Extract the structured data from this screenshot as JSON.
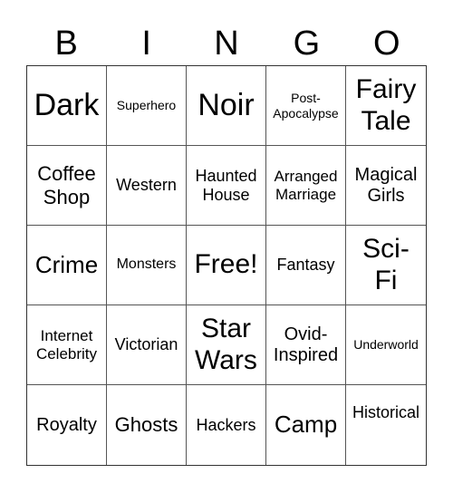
{
  "header": [
    "B",
    "I",
    "N",
    "G",
    "O"
  ],
  "cells": [
    "Dark",
    "Superhero",
    "Noir",
    "Post-\nApocalypse",
    "Fairy\nTale",
    "Coffee\nShop",
    "Western",
    "Haunted\nHouse",
    "Arranged\nMarriage",
    "Magical\nGirls",
    "Crime",
    "Monsters",
    "Free!",
    "Fantasy",
    "Sci-\nFi",
    "Internet\nCelebrity",
    "Victorian",
    "Star\nWars",
    "Ovid-\nInspired",
    "Underworld",
    "Royalty",
    "Ghosts",
    "Hackers",
    "Camp",
    "Historical"
  ]
}
